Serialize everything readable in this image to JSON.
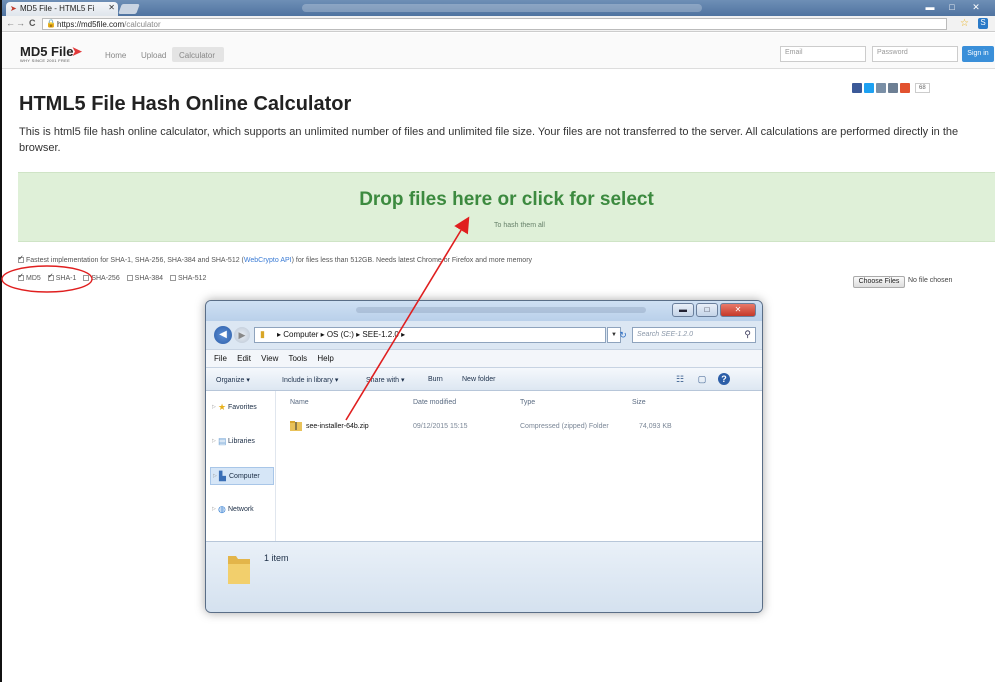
{
  "browser": {
    "tab_title": "MD5 File - HTML5 Fi",
    "url_host": "https://md5file.com",
    "url_path": "/calculator"
  },
  "site": {
    "logo": "MD5 File",
    "logo_tagline": "WHY SINCE 2001 FREE",
    "nav": {
      "home": "Home",
      "upload": "Upload",
      "calculator": "Calculator"
    },
    "email_placeholder": "Email",
    "password_placeholder": "Password",
    "signin_label": "Sign in",
    "share_count": "68"
  },
  "page": {
    "title": "HTML5 File Hash Online Calculator",
    "intro": "This is html5 file hash online calculator, which supports an unlimited number of files and unlimited file size. Your files are not transferred to the server. All calculations are performed directly in the browser.",
    "drop_title": "Drop files here or click for select",
    "drop_sub": "To hash them all",
    "fast_prefix": "Fastest implementation for SHA-1, SHA-256, SHA-384 and SHA-512 (",
    "fast_link": "WebCrypto API",
    "fast_suffix": ") for files less than 512GB. Needs latest Chrome or Firefox and more memory",
    "algorithms": [
      {
        "label": "MD5",
        "checked": true
      },
      {
        "label": "SHA-1",
        "checked": true
      },
      {
        "label": "SHA-256",
        "checked": false
      },
      {
        "label": "SHA-384",
        "checked": false
      },
      {
        "label": "SHA-512",
        "checked": false
      }
    ],
    "choose_files": "Choose Files",
    "no_file": "No file chosen"
  },
  "explorer": {
    "path": "▸ Computer ▸ OS (C:) ▸ SEE-1.2.0 ▸",
    "search_placeholder": "Search SEE-1.2.0",
    "menu": [
      "File",
      "Edit",
      "View",
      "Tools",
      "Help"
    ],
    "toolbar": {
      "organize": "Organize ▾",
      "include": "Include in library ▾",
      "share": "Share with ▾",
      "burn": "Burn",
      "new_folder": "New folder"
    },
    "nav": [
      "Favorites",
      "Libraries",
      "Computer",
      "Network"
    ],
    "columns": {
      "name": "Name",
      "date": "Date modified",
      "type": "Type",
      "size": "Size"
    },
    "file": {
      "name": "see-installer-64b.zip",
      "date": "09/12/2015 15:15",
      "type": "Compressed (zipped) Folder",
      "size": "74,093 KB"
    },
    "status": "1 item"
  },
  "colors": {
    "drop_bg": "#dff0d8",
    "drop_text": "#3c8a3f",
    "annotation": "#e01f1f",
    "signin": "#3a8fd9"
  }
}
